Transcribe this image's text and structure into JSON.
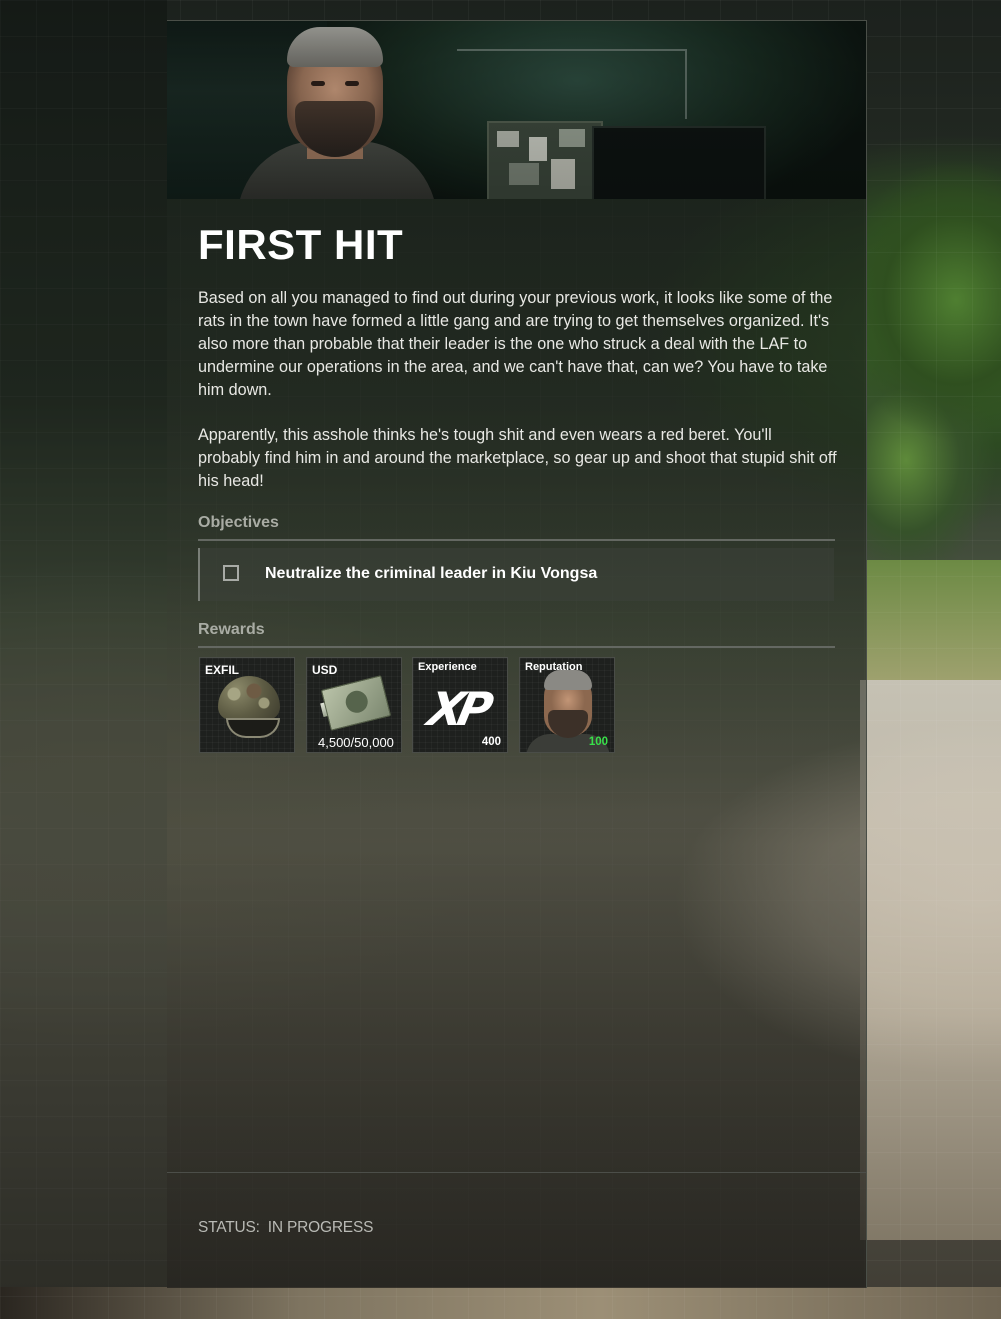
{
  "mission": {
    "title": "FIRST HIT",
    "description": [
      "Based on all you managed to find out during your previous work, it looks like some of the rats in the town have formed a little gang and are trying to get themselves organized. It's also more than probable that their leader is the one who struck a deal with the LAF to undermine our operations in the area, and we can't have that, can we? You have to take him down.",
      "Apparently, this asshole thinks he's tough shit and even wears a red beret. You'll probably find him in and around the marketplace, so gear up and shoot that stupid shit off his head!"
    ]
  },
  "objectives": {
    "heading": "Objectives",
    "items": [
      {
        "text": "Neutralize the criminal leader in Kiu Vongsa",
        "completed": false
      }
    ]
  },
  "rewards": {
    "heading": "Rewards",
    "items": [
      {
        "label": "EXFIL",
        "value": "",
        "icon": "helmet-icon"
      },
      {
        "label": "USD",
        "value": "4,500/50,000",
        "icon": "cash-icon"
      },
      {
        "label": "Experience",
        "value": "400",
        "icon": "xp-icon"
      },
      {
        "label": "Reputation",
        "value": "100",
        "icon": "trader-portrait",
        "value_color": "#39e04a"
      }
    ]
  },
  "status": {
    "label": "STATUS:",
    "value": "IN PROGRESS"
  }
}
